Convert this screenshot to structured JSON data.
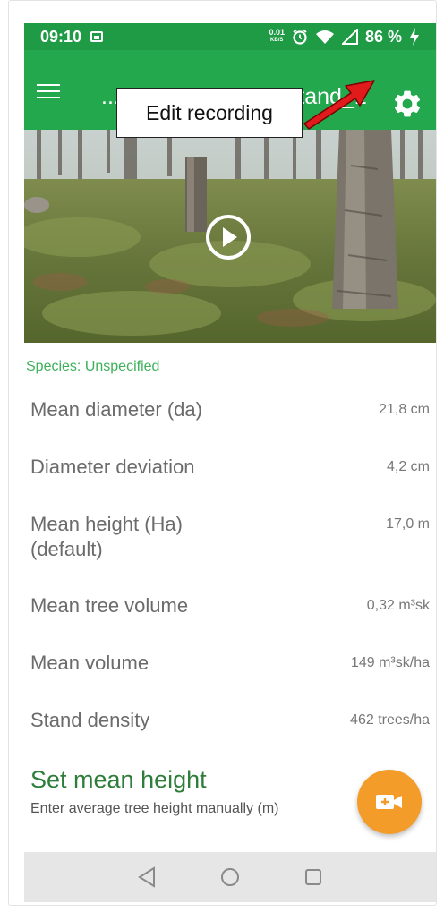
{
  "status_bar": {
    "time": "09:10",
    "speed_value": "0.01",
    "speed_unit": "KB/S",
    "battery": "86 %"
  },
  "app_bar": {
    "title": "...tand > Example-Stand_1",
    "menu_icon": "hamburger-menu-icon",
    "settings_icon": "gear-icon"
  },
  "annotation": {
    "callout_text": "Edit recording",
    "arrow_color": "#e11b1b"
  },
  "species": "Species: Unspecified",
  "stats": [
    {
      "label": "Mean diameter (da)",
      "value": "21,8 cm"
    },
    {
      "label": "Diameter deviation",
      "value": "4,2 cm"
    },
    {
      "label": "Mean height (Ha)\n(default)",
      "value": "17,0 m"
    },
    {
      "label": "Mean tree volume",
      "value": "0,32 m³sk"
    },
    {
      "label": "Mean volume",
      "value": "149 m³sk/ha"
    },
    {
      "label": "Stand density",
      "value": "462 trees/ha"
    }
  ],
  "set_height": {
    "title": "Set mean height",
    "subtitle": "Enter average tree height manually (m)"
  },
  "colors": {
    "status_green": "#1f9a45",
    "appbar_green": "#23a84e",
    "species_green": "#3cb15a",
    "fab_orange": "#f39c2a"
  }
}
